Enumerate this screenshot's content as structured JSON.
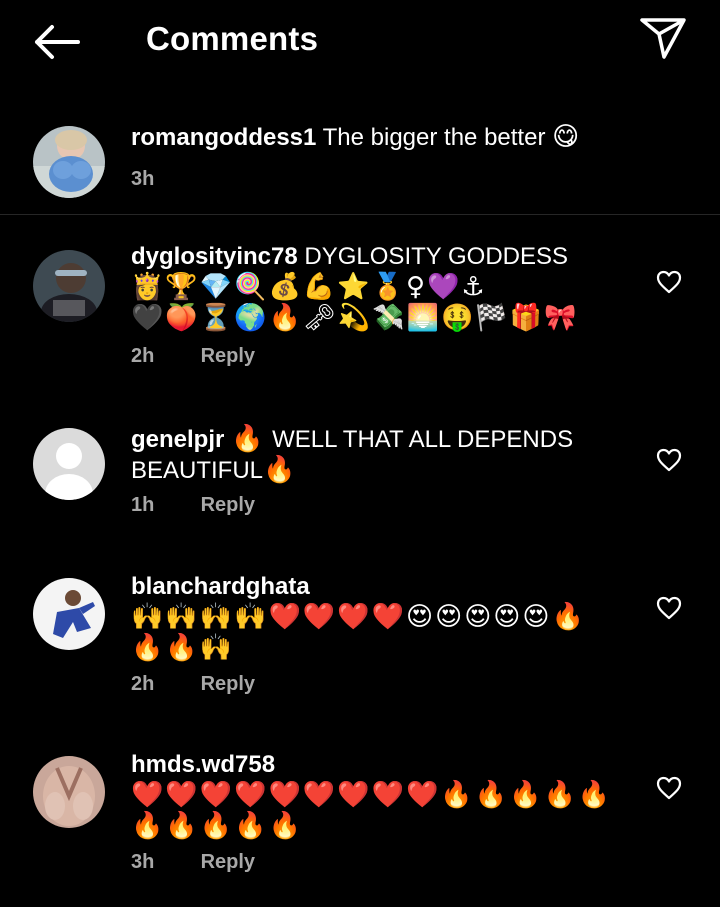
{
  "header": {
    "title": "Comments",
    "back_icon": "arrow-left-icon",
    "share_icon": "paper-plane-icon"
  },
  "caption": {
    "username": "romangoddess1",
    "text": "The bigger the better",
    "emoji": "😋",
    "time": "3h"
  },
  "comments": [
    {
      "username": "dyglosityinc78",
      "text": "DYGLOSITY GODDESS",
      "emoji_line1": "👸🏆💎🍭💰💪⭐🏅♀💜⚓",
      "emoji_line2": "🖤🍑⏳🌍🔥🗝💫💸🌅🤑🏁🎁🎀",
      "time": "2h",
      "reply": "Reply"
    },
    {
      "username": "genelpjr",
      "text_prefix_emoji": "🔥",
      "text": "WELL THAT ALL DEPENDS BEAUTIFUL",
      "text_suffix_emoji": "🔥",
      "time": "1h",
      "reply": "Reply"
    },
    {
      "username": "blanchardghata",
      "emoji_line1": "🙌🙌🙌🙌❤️❤️❤️❤️😍😍😍😍😍🔥",
      "emoji_line2": "🔥🔥🙌",
      "time": "2h",
      "reply": "Reply"
    },
    {
      "username": "hmds.wd758",
      "emoji_line1": "❤️❤️❤️❤️❤️❤️❤️❤️❤️🔥🔥🔥🔥🔥",
      "emoji_line2": "🔥🔥🔥🔥🔥",
      "time": "3h",
      "reply": "Reply"
    }
  ],
  "colors": {
    "background": "#000000",
    "text": "#ffffff",
    "meta": "#a8a8a8",
    "divider": "#262626"
  }
}
